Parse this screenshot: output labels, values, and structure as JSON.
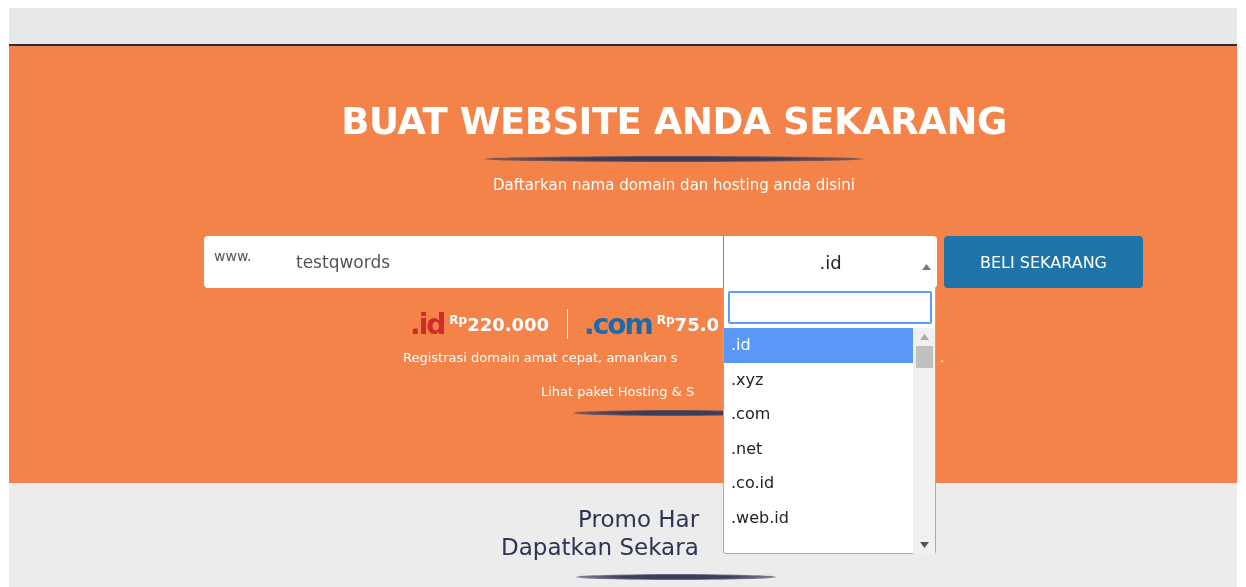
{
  "hero": {
    "title": "BUAT WEBSITE ANDA SEKARANG",
    "subtitle": "Daftarkan nama domain dan hosting anda disini"
  },
  "search": {
    "prefix": "www.",
    "value": "testqwords",
    "tld": ".id",
    "button": "BELI SEKARANG"
  },
  "prices": [
    {
      "tld": ".id",
      "currency": "Rp",
      "price": "220.000"
    },
    {
      "tld": ".com",
      "currency": "Rp",
      "price": "75.0"
    }
  ],
  "note": "Registrasi domain amat cepat, amankan s",
  "note_tail": ".",
  "link": "Lihat paket Hosting & S",
  "dropdown": {
    "options": [
      {
        "label": ".id",
        "selected": true
      },
      {
        "label": ".xyz",
        "selected": false
      },
      {
        "label": ".com",
        "selected": false
      },
      {
        "label": ".net",
        "selected": false
      },
      {
        "label": ".co.id",
        "selected": false
      },
      {
        "label": ".web.id",
        "selected": false
      }
    ]
  },
  "promo": {
    "line_1": "Promo Har",
    "line_2": "Dapatkan Sekara"
  }
}
